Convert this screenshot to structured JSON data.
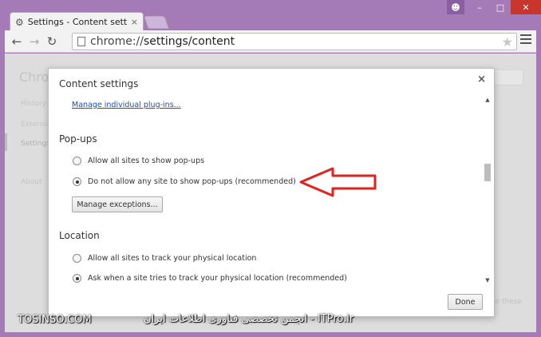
{
  "browser": {
    "tab_title": "Settings - Content settings",
    "url_prefix": "chrome://",
    "url_path": "settings/content",
    "tab_close": "×"
  },
  "background_page": {
    "heading": "Chro",
    "nav": [
      "History",
      "Extensions",
      "Settings",
      "About"
    ],
    "right_note": "le these"
  },
  "dialog": {
    "title": "Content settings",
    "close": "×",
    "manage_plugins_link": "Manage individual plug-ins...",
    "popups": {
      "heading": "Pop-ups",
      "options": [
        {
          "label": "Allow all sites to show pop-ups",
          "checked": false
        },
        {
          "label": "Do not allow any site to show pop-ups (recommended)",
          "checked": true
        }
      ],
      "manage_button": "Manage exceptions..."
    },
    "location": {
      "heading": "Location",
      "options": [
        {
          "label": "Allow all sites to track your physical location",
          "checked": false
        },
        {
          "label": "Ask when a site tries to track your physical location (recommended)",
          "checked": true
        }
      ]
    },
    "done_button": "Done"
  },
  "annotation": {
    "color": "#e0231f",
    "icon": "left-arrow-outline"
  },
  "watermarks": {
    "left": "TOSINSO.COM",
    "right": "ITPro.ir - انجمن تخصصی فناوری اطلاعات ایران"
  },
  "colors": {
    "frame": "#a47bb6",
    "link": "#1a4fb5",
    "close_button": "#c7352c"
  }
}
